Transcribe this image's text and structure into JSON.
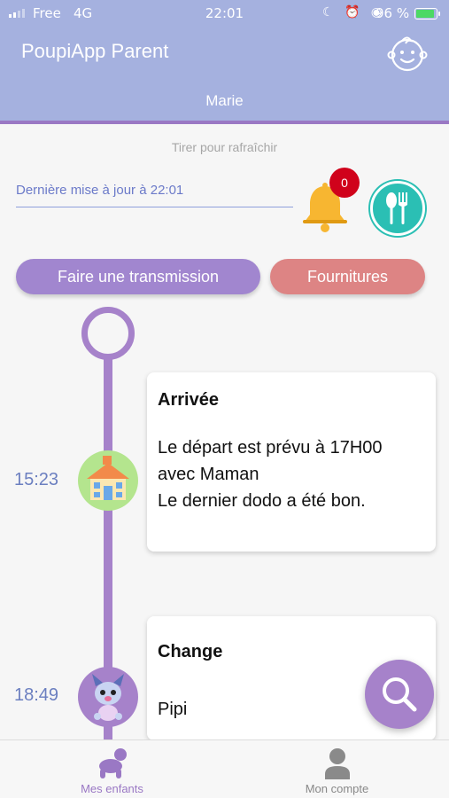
{
  "status_bar": {
    "carrier": "Free",
    "network": "4G",
    "time": "22:01",
    "icons": "☾ ⏰ ◉",
    "battery_pct": "96 %",
    "battery_level": 0.96,
    "battery_color": "#4cd964"
  },
  "header": {
    "title": "PoupiApp Parent",
    "profile_icon": "baby-face-icon"
  },
  "child_tab": {
    "name": "Marie"
  },
  "refresh_hint": "Tirer pour rafraîchir",
  "last_update": "Dernière mise à jour à 22:01",
  "notifications": {
    "count": "0",
    "icon": "bell-icon"
  },
  "meal_icon": "spoon-fork-icon",
  "buttons": {
    "transmission": "Faire une transmission",
    "supplies": "Fournitures"
  },
  "timeline": [
    {
      "time": "15:23",
      "icon": "house-icon",
      "title": "Arrivée",
      "body": "Le départ est prévu à 17H00\navec Maman\nLe dernier dodo a été bon."
    },
    {
      "time": "18:49",
      "icon": "dog-icon",
      "title": "Change",
      "body": "Pipi"
    }
  ],
  "search_icon": "search-icon",
  "bottom_nav": {
    "children": "Mes enfants",
    "account": "Mon compte"
  },
  "colors": {
    "header": "#a5b1df",
    "accent": "#a682ca",
    "supplies": "#dd8484",
    "meal": "#2bbfb4",
    "badge": "#d0021b"
  }
}
